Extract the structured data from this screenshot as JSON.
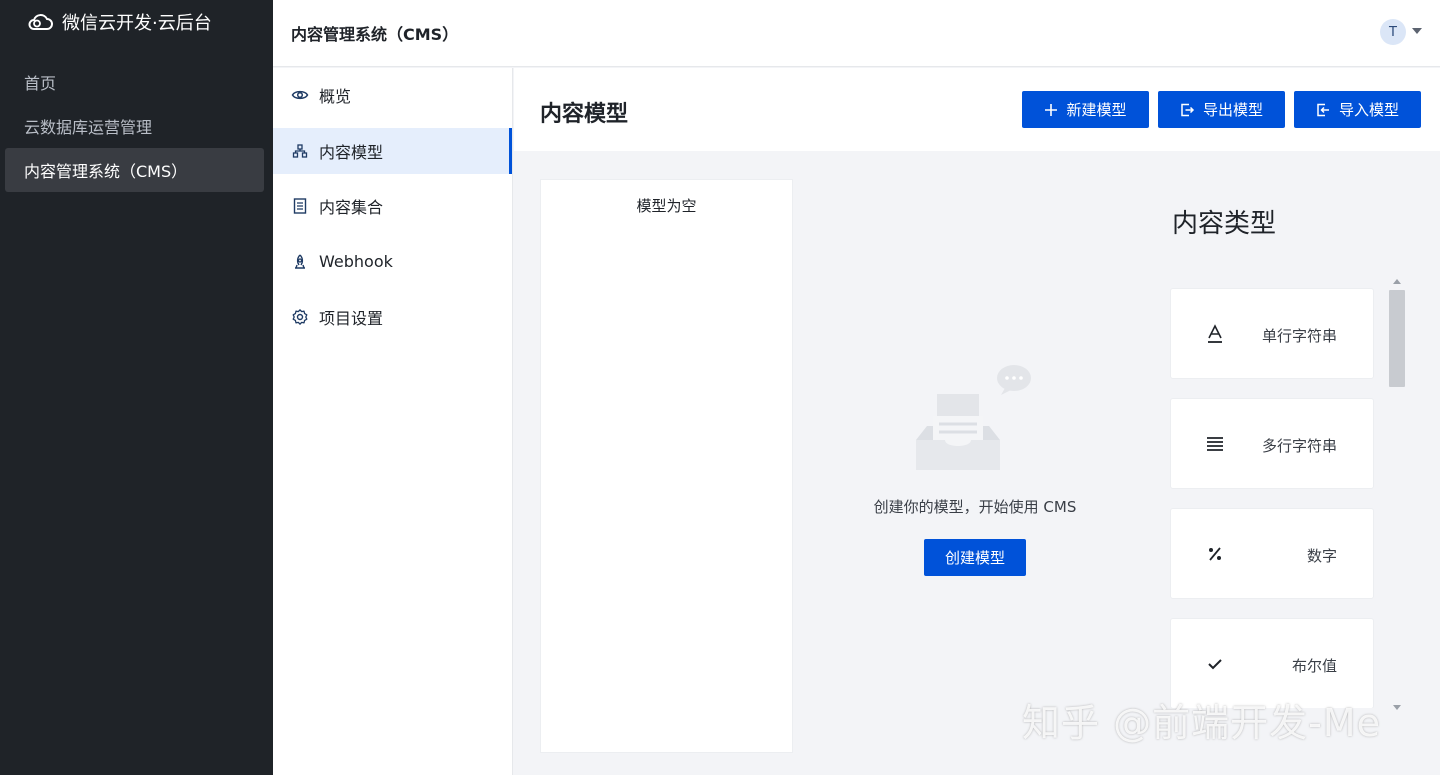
{
  "app": {
    "brand": "微信云开发·云后台"
  },
  "sidebar": {
    "items": [
      {
        "label": "首页",
        "active": false
      },
      {
        "label": "云数据库运营管理",
        "active": false
      },
      {
        "label": "内容管理系统（CMS）",
        "active": true
      }
    ]
  },
  "header": {
    "title": "内容管理系统（CMS）",
    "avatar": "T"
  },
  "submenu": {
    "items": [
      {
        "label": "概览",
        "icon": "eye-icon"
      },
      {
        "label": "内容模型",
        "icon": "hierarchy-icon",
        "active": true
      },
      {
        "label": "内容集合",
        "icon": "document-list-icon"
      },
      {
        "label": "Webhook",
        "icon": "webhook-icon"
      },
      {
        "label": "项目设置",
        "icon": "gear-icon"
      }
    ]
  },
  "content": {
    "title": "内容模型",
    "buttons": {
      "new_model": "新建模型",
      "export_model": "导出模型",
      "import_model": "导入模型"
    }
  },
  "model_list": {
    "empty_text": "模型为空"
  },
  "empty_state": {
    "message": "创建你的模型，开始使用 CMS",
    "create_button": "创建模型"
  },
  "content_types": {
    "title": "内容类型",
    "items": [
      {
        "label": "单行字符串",
        "icon": "text-a-icon"
      },
      {
        "label": "多行字符串",
        "icon": "lines-icon"
      },
      {
        "label": "数字",
        "icon": "percent-icon"
      },
      {
        "label": "布尔值",
        "icon": "check-icon"
      }
    ]
  },
  "watermark": "知乎 @前端开发-Me",
  "colors": {
    "primary": "#0052d9",
    "sidebar_bg": "#1f2328",
    "active_sub_bg": "#e5eefc"
  }
}
